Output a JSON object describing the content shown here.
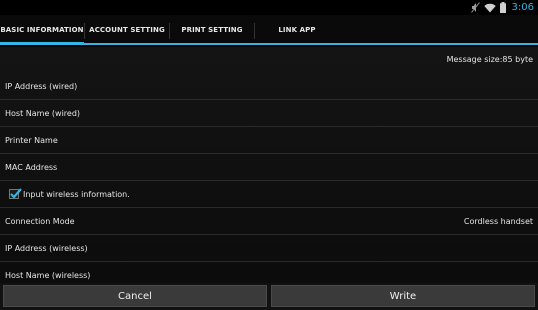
{
  "status": {
    "time": "3:06",
    "icons": [
      "mute-icon",
      "wifi-icon",
      "battery-icon"
    ]
  },
  "tabs": [
    {
      "label": "BASIC INFORMATION",
      "active": true
    },
    {
      "label": "ACCOUNT SETTING",
      "active": false
    },
    {
      "label": "PRINT SETTING",
      "active": false
    },
    {
      "label": "LINK APP",
      "active": false
    }
  ],
  "message_size": "Message size:85 byte",
  "fields": {
    "ip_wired": "IP Address (wired)",
    "host_wired": "Host Name (wired)",
    "printer_name": "Printer Name",
    "mac_address": "MAC Address",
    "wireless_checkbox": {
      "label": "Input wireless information.",
      "checked": true
    },
    "connection_mode": {
      "label": "Connection Mode",
      "value": "Cordless handset"
    },
    "ip_wireless": "IP Address (wireless)",
    "host_wireless": "Host Name (wireless)"
  },
  "buttons": {
    "cancel": "Cancel",
    "write": "Write"
  },
  "colors": {
    "accent": "#33b5e5",
    "background": "#000000",
    "button": "#3a3a3a"
  }
}
